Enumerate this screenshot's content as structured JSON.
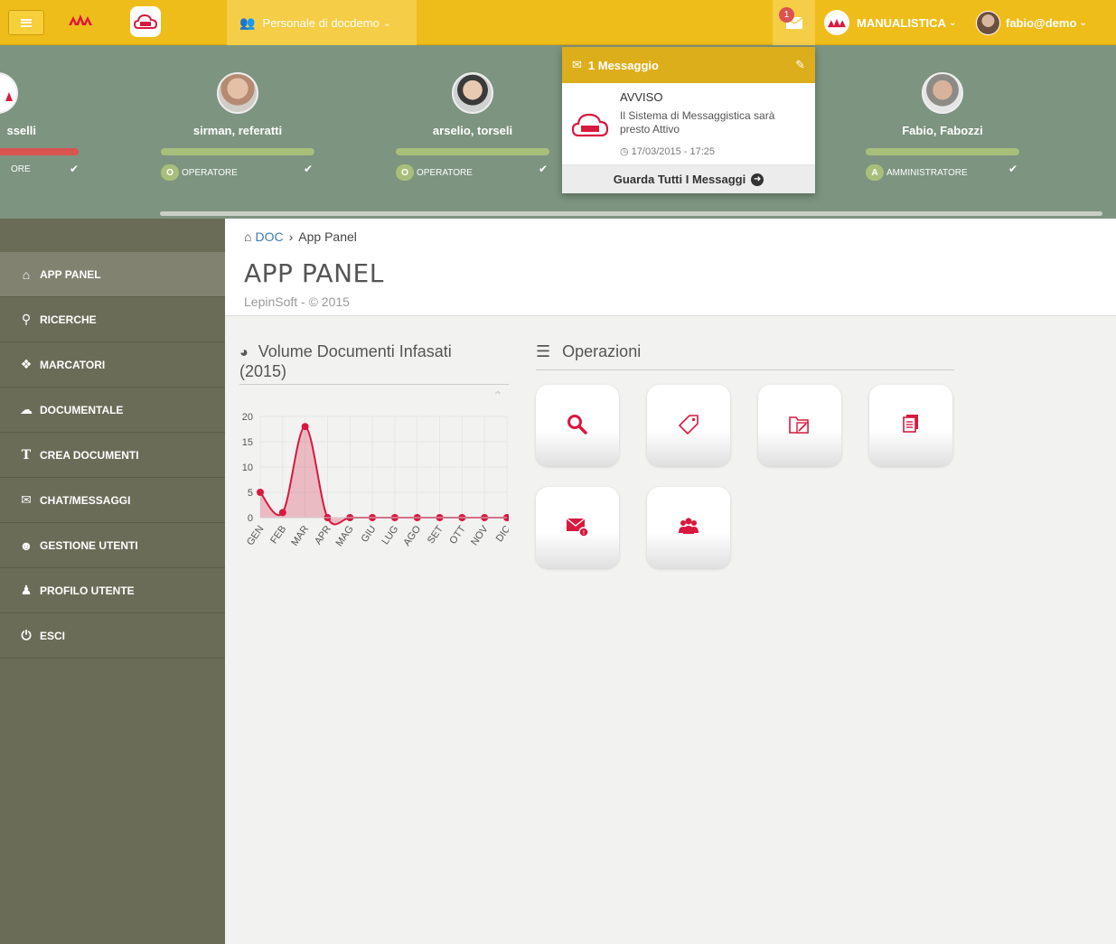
{
  "topbar": {
    "group_label": "Personale di docdemo",
    "message_count": "1",
    "org_label": "MANUALISTICA",
    "user_label": "fabio@demo"
  },
  "users": [
    {
      "name": "sselli",
      "role_letter": "",
      "role": "ORE",
      "bar_color": "#d9534f"
    },
    {
      "name": "sirman, referatti",
      "role_letter": "O",
      "role": "OPERATORE",
      "bar_color": "#a8bf7a"
    },
    {
      "name": "arselio, torseli",
      "role_letter": "O",
      "role": "OPERATORE",
      "bar_color": "#a8bf7a"
    },
    {
      "name": "Fabio, Fabozzi",
      "role_letter": "A",
      "role": "AMMINISTRATORE",
      "bar_color": "#a8bf7a"
    }
  ],
  "messages": {
    "header": "1 Messaggio",
    "item": {
      "title": "AVVISO",
      "text": "Il Sistema di Messaggistica sarà presto Attivo",
      "time": "17/03/2015 - 17:25"
    },
    "footer": "Guarda Tutti I Messaggi"
  },
  "sidebar": {
    "items": [
      {
        "label": "APP PANEL",
        "icon": "home-icon"
      },
      {
        "label": "RICERCHE",
        "icon": "search-icon"
      },
      {
        "label": "MARCATORI",
        "icon": "tags-icon"
      },
      {
        "label": "DOCUMENTALE",
        "icon": "cloud-upload-icon"
      },
      {
        "label": "CREA DOCUMENTI",
        "icon": "text-icon"
      },
      {
        "label": "CHAT/MESSAGGI",
        "icon": "envelope-icon"
      },
      {
        "label": "GESTIONE UTENTI",
        "icon": "users-icon"
      },
      {
        "label": "PROFILO UTENTE",
        "icon": "user-icon"
      },
      {
        "label": "ESCI",
        "icon": "power-icon"
      }
    ]
  },
  "breadcrumb": {
    "home": "DOC",
    "current": "App Panel"
  },
  "page": {
    "title": "APP PANEL",
    "subtitle": "LepinSoft - © 2015"
  },
  "chart_panel": {
    "title_line1": "Volume Documenti Infasati",
    "title_line2": "(2015)"
  },
  "chart_data": {
    "type": "area",
    "categories": [
      "GEN",
      "FEB",
      "MAR",
      "APR",
      "MAG",
      "GIU",
      "LUG",
      "AGO",
      "SET",
      "OTT",
      "NOV",
      "DIC"
    ],
    "values": [
      5,
      1,
      18,
      0,
      0,
      0,
      0,
      0,
      0,
      0,
      0,
      0
    ],
    "y_ticks": [
      0,
      5,
      10,
      15,
      20
    ],
    "ylim": [
      0,
      20
    ],
    "grid": true,
    "color": "#d8193f"
  },
  "ops_panel": {
    "title": "Operazioni",
    "tiles": [
      "search-icon",
      "tag-icon",
      "folder-edit-icon",
      "document-icon",
      "mail-alert-icon",
      "users-icon"
    ]
  }
}
